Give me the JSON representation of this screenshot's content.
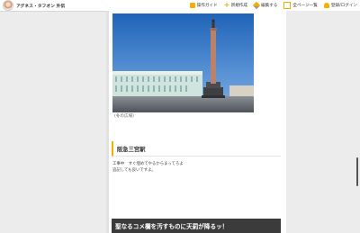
{
  "header": {
    "site_title": "アグネス・タフオン 外伝",
    "nav": [
      {
        "label": "操作ガイド",
        "icon": "book-icon"
      },
      {
        "label": "新規作成",
        "icon": "plus-icon"
      },
      {
        "label": "編集する",
        "icon": "pencil-icon"
      },
      {
        "label": "全ページ一覧",
        "icon": "page-icon"
      },
      {
        "label": "登録/ログイン",
        "icon": "user-icon"
      }
    ]
  },
  "article": {
    "image_caption": "(冬の広場)",
    "section_heading": "阪急三宮駅",
    "body_lines": [
      "工事中　すぐ埋めてやるからまってろよ",
      "追記しても良いですよ。"
    ],
    "next_heading": "聖なるコメ欄を汚すものに天罰が降るッ！"
  },
  "colors": {
    "accent": "#f2b100",
    "dark_heading_bg": "#3b3b3b",
    "page_bg": "#ececec"
  }
}
